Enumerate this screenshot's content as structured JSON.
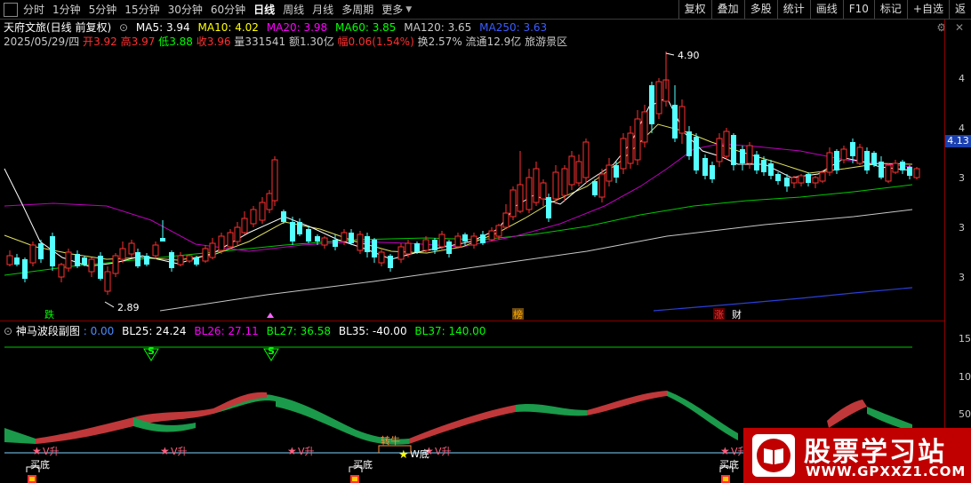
{
  "toolbar": {
    "periods": [
      "分时",
      "1分钟",
      "5分钟",
      "15分钟",
      "30分钟",
      "60分钟",
      "日线",
      "周线",
      "月线",
      "多周期",
      "更多"
    ],
    "active_period": "日线",
    "right_buttons": [
      "复权",
      "叠加",
      "多股",
      "统计",
      "画线",
      "F10",
      "标记",
      "+自选",
      "返"
    ]
  },
  "header": {
    "stock_title": "天府文旅(日线 前复权)",
    "ma": [
      {
        "label": "MA5: 3.94",
        "color": "#ffffff"
      },
      {
        "label": "MA10: 4.02",
        "color": "#ffff00"
      },
      {
        "label": "MA20: 3.98",
        "color": "#ff00ff"
      },
      {
        "label": "MA60: 3.85",
        "color": "#00ff00"
      },
      {
        "label": "MA120: 3.65",
        "color": "#c8c8c8"
      },
      {
        "label": "MA250: 3.63",
        "color": "#3a5cff"
      }
    ],
    "quote": {
      "date": "2025/05/29/四",
      "open_label": "开",
      "open": "3.92",
      "high_label": "高",
      "high": "3.97",
      "low_label": "低",
      "low": "3.88",
      "close_label": "收",
      "close": "3.96",
      "vol_label": "量",
      "vol": "331541",
      "amount_label": "额",
      "amount": "1.30亿",
      "chg_label": "幅",
      "chg": "0.06(1.54%)",
      "turnover_label": "换",
      "turnover": "2.57%",
      "float_label": "流通",
      "float_mv": "12.9亿",
      "sector": "旅游景区"
    }
  },
  "main_chart": {
    "y_labels": [
      "4",
      "4",
      "3",
      "3",
      "3"
    ],
    "current_price": "4.13",
    "high_marker": "4.90",
    "low_marker": "2.89",
    "event_tags": [
      {
        "text": "跌",
        "color": "#00ff00"
      },
      {
        "text": "榜",
        "color": "#ff8c00"
      },
      {
        "text": "涨",
        "color": "#ff3030"
      },
      {
        "text": "财",
        "color": "#ffffff"
      }
    ]
  },
  "indicator": {
    "name": "神马波段副图",
    "values": [
      {
        "label": ": 0.00",
        "color": "#ffffff"
      },
      {
        "label": "BL25: 24.24",
        "color": "#ffffff"
      },
      {
        "label": "BL26: 27.11",
        "color": "#ff00ff"
      },
      {
        "label": "BL27: 36.58",
        "color": "#00ff00"
      },
      {
        "label": "BL35: -40.00",
        "color": "#ffffff"
      },
      {
        "label": "BL37: 140.00",
        "color": "#00ff00"
      }
    ],
    "y_labels": [
      "15",
      "10",
      "5",
      "50"
    ],
    "signals": {
      "s": "S",
      "v_up": "V升",
      "w_bottom": "W底",
      "buy_bottom": "买底",
      "turn_bull": "转牛"
    }
  },
  "watermark": {
    "text": "股票学习站",
    "url": "WWW.GPXXZ1.COM"
  }
}
